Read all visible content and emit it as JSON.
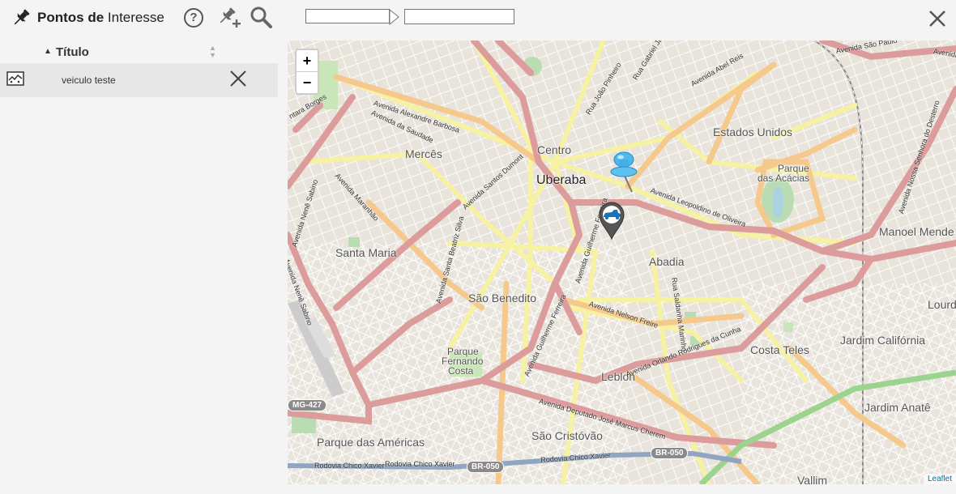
{
  "header": {
    "title_bold": "Pontos de",
    "title_rest": "Interesse",
    "help_symbol": "?",
    "field_b_value": ""
  },
  "list": {
    "column_title": "Título",
    "rows": [
      {
        "label": "veiculo teste"
      }
    ]
  },
  "map": {
    "zoom_in": "+",
    "zoom_out": "−",
    "attribution": "Leaflet",
    "places": {
      "uberaba": "Uberaba",
      "centro": "Centro",
      "merces": "Mercês",
      "estados_unidos": "Estados Unidos",
      "parque_acacias_1": "Parque",
      "parque_acacias_2": "das Acácias",
      "manoel_mendes": "Manoel Mende",
      "abadia": "Abadia",
      "santa_maria": "Santa Maria",
      "sao_benedito": "São Benedito",
      "parque_fc_1": "Parque",
      "parque_fc_2": "Fernando",
      "parque_fc_3": "Costa",
      "leblon": "Leblon",
      "costa_teles": "Costa Teles",
      "jardim_california": "Jardim Califórnia",
      "lourdes": "Lourd",
      "jardim_anate": "Jardim Anatê",
      "parque_americas": "Parque das Américas",
      "sao_cristovao": "São Cristóvão",
      "vallim": "Vallim"
    },
    "roads": {
      "alexandre_barbosa": "Avenida Alexandre Barbosa",
      "saudade": "Avenida da Saudade",
      "abel_reis": "Avenida Abel Reis",
      "joao_pinheiro": "Rua João Pinheiro",
      "gabriel": "Rua Gabriel Ja",
      "sao_paulo": "Avenida São Paulo",
      "santos_dumont": "Avenida Santos Dumont",
      "leopoldino": "Avenida Leopoldino de Oliveira",
      "marajo": "Avenida Maranhão",
      "nene_sabino": "Avenida Nenê Sabino",
      "beatriz": "Avenida Santa Beatriz Silva",
      "guilherme_ferreira": "Avenida Guilherme Ferreira",
      "nelson_freire": "Avenida Nelson Freire",
      "saldanha": "Rua Saldanha Marinho",
      "orlando": "Avenida Orlando Rodrigues da Cunha",
      "deputado": "Avenida Deputado José Marcus Cherem",
      "chico_xavier": "Rodovia Chico Xavier",
      "senhora_desterro": "Avenida Nossa Senhora do Desterro",
      "borges": "ntara Borges",
      "avenida_edge": "Avenida"
    },
    "shields": {
      "mg427": "MG-427",
      "br050a": "BR-050",
      "br050b": "BR-050"
    }
  }
}
